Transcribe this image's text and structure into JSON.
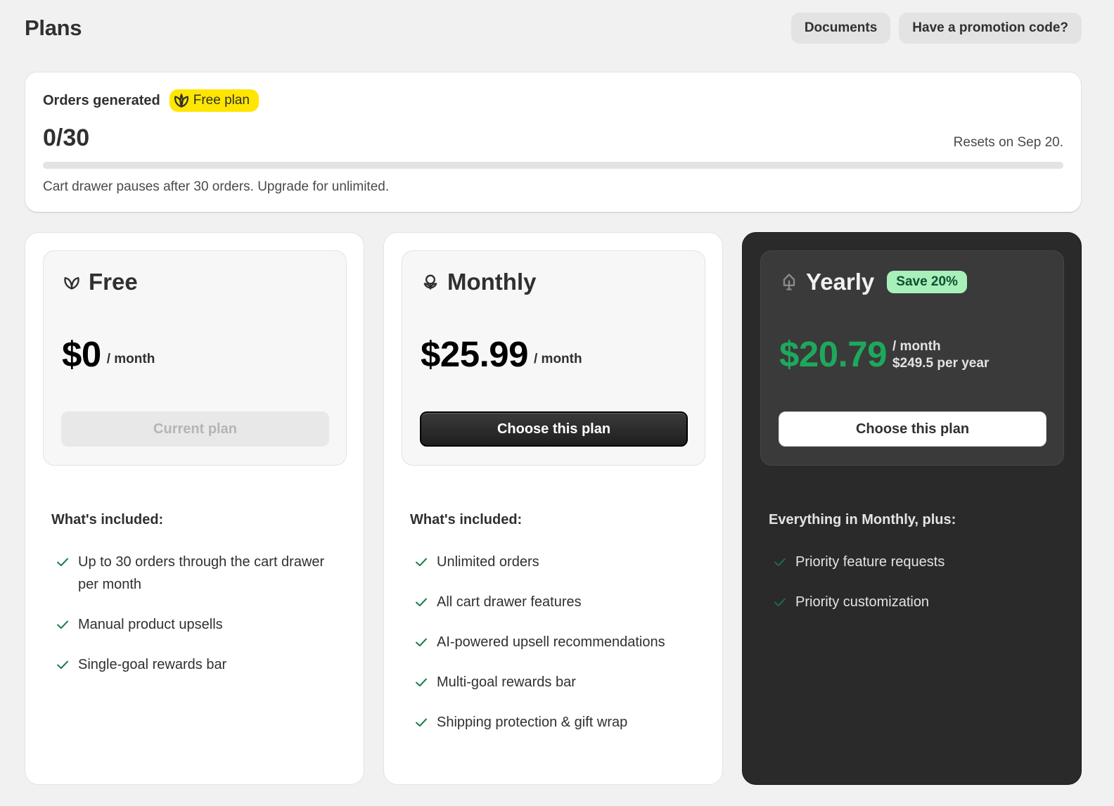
{
  "header": {
    "title": "Plans",
    "documents_label": "Documents",
    "promo_label": "Have a promotion code?"
  },
  "usage": {
    "label": "Orders generated",
    "badge": "Free plan",
    "value": "0/30",
    "progress_fraction": 0,
    "reset_text": "Resets on Sep 20.",
    "note": "Cart drawer pauses after 30 orders. Upgrade for unlimited."
  },
  "plans": [
    {
      "name": "Free",
      "icon": "leaf-icon",
      "price": "$0",
      "unit": "/ month",
      "button": "Current plan",
      "features_title": "What's included:",
      "features": [
        "Up to 30 orders through the cart drawer per month",
        "Manual product upsells",
        "Single-goal rewards bar"
      ]
    },
    {
      "name": "Monthly",
      "icon": "flower-icon",
      "price": "$25.99",
      "unit": "/ month",
      "button": "Choose this plan",
      "features_title": "What's included:",
      "features": [
        "Unlimited orders",
        "All cart drawer features",
        "AI-powered upsell recommendations",
        "Multi-goal rewards bar",
        "Shipping protection & gift wrap"
      ]
    },
    {
      "name": "Yearly",
      "icon": "tree-icon",
      "badge": "Save 20%",
      "price": "$20.79",
      "unit": "/ month",
      "unit_sub": "$249.5 per year",
      "button": "Choose this plan",
      "features_title": "Everything in Monthly, plus:",
      "features": [
        "Priority feature requests",
        "Priority customization"
      ]
    }
  ],
  "colors": {
    "background": "#f1f1f1",
    "badge_yellow": "#ffe600",
    "save_badge_green": "#a7f0ba",
    "price_green": "#1ea85c",
    "check_green": "#1a7f4b",
    "dark_card": "#2a2a2a"
  }
}
